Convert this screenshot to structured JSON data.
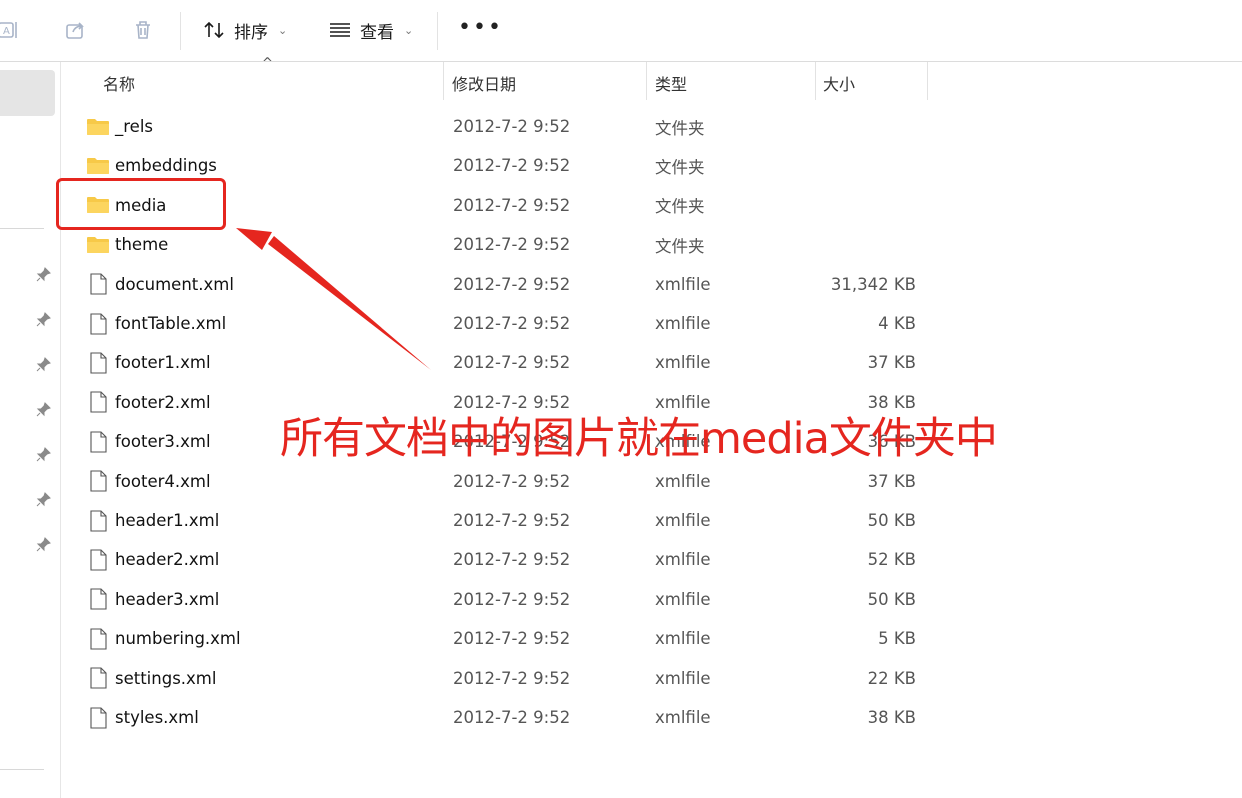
{
  "toolbar": {
    "sort_label": "排序",
    "view_label": "查看",
    "more_label": "•••"
  },
  "columns": {
    "name": "名称",
    "date": "修改日期",
    "type": "类型",
    "size": "大小"
  },
  "files": [
    {
      "name": "_rels",
      "date": "2012-7-2 9:52",
      "type": "文件夹",
      "size": "",
      "kind": "folder"
    },
    {
      "name": "embeddings",
      "date": "2012-7-2 9:52",
      "type": "文件夹",
      "size": "",
      "kind": "folder"
    },
    {
      "name": "media",
      "date": "2012-7-2 9:52",
      "type": "文件夹",
      "size": "",
      "kind": "folder"
    },
    {
      "name": "theme",
      "date": "2012-7-2 9:52",
      "type": "文件夹",
      "size": "",
      "kind": "folder"
    },
    {
      "name": "document.xml",
      "date": "2012-7-2 9:52",
      "type": "xmlfile",
      "size": "31,342 KB",
      "kind": "file"
    },
    {
      "name": "fontTable.xml",
      "date": "2012-7-2 9:52",
      "type": "xmlfile",
      "size": "4 KB",
      "kind": "file"
    },
    {
      "name": "footer1.xml",
      "date": "2012-7-2 9:52",
      "type": "xmlfile",
      "size": "37 KB",
      "kind": "file"
    },
    {
      "name": "footer2.xml",
      "date": "2012-7-2 9:52",
      "type": "xmlfile",
      "size": "38 KB",
      "kind": "file"
    },
    {
      "name": "footer3.xml",
      "date": "2012-7-2 9:52",
      "type": "xmlfile",
      "size": "36 KB",
      "kind": "file"
    },
    {
      "name": "footer4.xml",
      "date": "2012-7-2 9:52",
      "type": "xmlfile",
      "size": "37 KB",
      "kind": "file"
    },
    {
      "name": "header1.xml",
      "date": "2012-7-2 9:52",
      "type": "xmlfile",
      "size": "50 KB",
      "kind": "file"
    },
    {
      "name": "header2.xml",
      "date": "2012-7-2 9:52",
      "type": "xmlfile",
      "size": "52 KB",
      "kind": "file"
    },
    {
      "name": "header3.xml",
      "date": "2012-7-2 9:52",
      "type": "xmlfile",
      "size": "50 KB",
      "kind": "file"
    },
    {
      "name": "numbering.xml",
      "date": "2012-7-2 9:52",
      "type": "xmlfile",
      "size": "5 KB",
      "kind": "file"
    },
    {
      "name": "settings.xml",
      "date": "2012-7-2 9:52",
      "type": "xmlfile",
      "size": "22 KB",
      "kind": "file"
    },
    {
      "name": "styles.xml",
      "date": "2012-7-2 9:52",
      "type": "xmlfile",
      "size": "38 KB",
      "kind": "file"
    }
  ],
  "annotation": {
    "text": "所有文档中的图片就在media文件夹中"
  },
  "colors": {
    "annotation": "#e5261f",
    "folder": "#f7c948",
    "selection": "#e5e5e5"
  }
}
